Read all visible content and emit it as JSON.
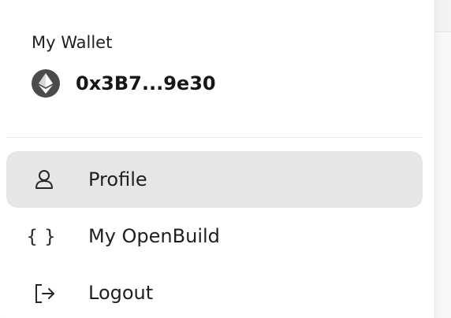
{
  "dropdown": {
    "wallet_title": "My Wallet",
    "wallet_address": "0x3B7...9e30",
    "wallet_icon": "ethereum-icon"
  },
  "menu": {
    "items": [
      {
        "label": "Profile",
        "icon": "user-icon",
        "state": "active"
      },
      {
        "label": "My OpenBuild",
        "icon": "braces-icon",
        "state": "default"
      },
      {
        "label": "Logout",
        "icon": "logout-icon",
        "state": "default"
      }
    ]
  },
  "colors": {
    "active_background": "#e6e6e6",
    "text": "#1f1f1f",
    "icon_badge": "#4b4b4b"
  }
}
